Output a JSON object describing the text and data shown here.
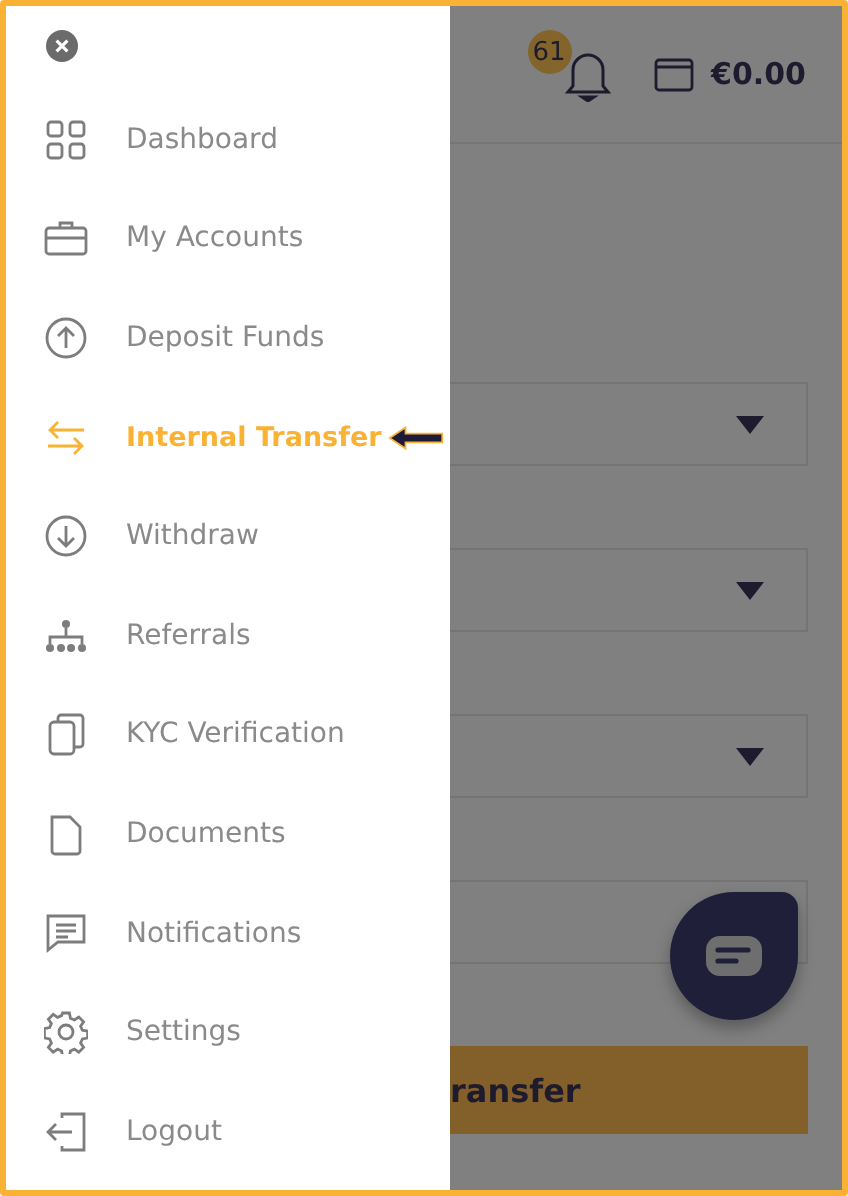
{
  "menu": {
    "items": [
      {
        "label": "Dashboard",
        "selected": false
      },
      {
        "label": "My Accounts",
        "selected": false
      },
      {
        "label": "Deposit Funds",
        "selected": false
      },
      {
        "label": "Internal Transfer",
        "selected": true
      },
      {
        "label": "Withdraw",
        "selected": false
      },
      {
        "label": "Referrals",
        "selected": false
      },
      {
        "label": "KYC Verification",
        "selected": false
      },
      {
        "label": "Documents",
        "selected": false
      },
      {
        "label": "Notifications",
        "selected": false
      },
      {
        "label": "Settings",
        "selected": false
      },
      {
        "label": "Logout",
        "selected": false
      }
    ]
  },
  "header": {
    "notification_count": "61",
    "balance": "€0.00"
  },
  "form": {
    "fields": [
      {
        "kind": "select"
      },
      {
        "kind": "select"
      },
      {
        "kind": "select"
      },
      {
        "kind": "input"
      }
    ],
    "submit_button": "ransfer"
  }
}
